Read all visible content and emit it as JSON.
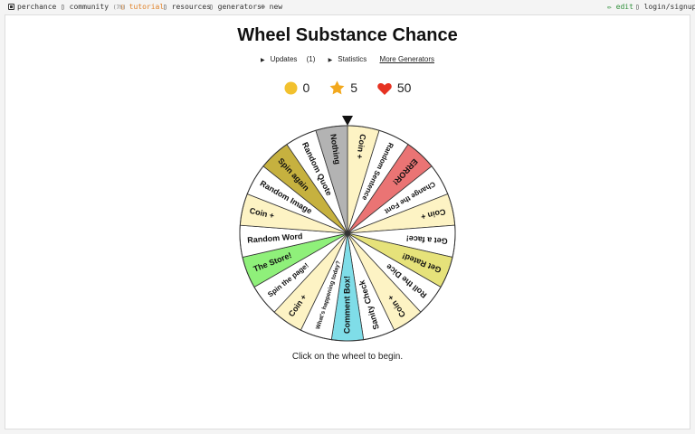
{
  "nav": {
    "brand": "perchance",
    "community": "community",
    "community_count": "(7h)",
    "tutorial": "tutorial",
    "resources": "resources",
    "generators": "generators",
    "new": "new",
    "edit": "edit",
    "login": "login/signup"
  },
  "page": {
    "title": "Wheel Substance Chance",
    "updates_label": "Updates",
    "updates_count": "(1)",
    "statistics_label": "Statistics",
    "more_generators": "More Generators",
    "instruction": "Click on the wheel to begin."
  },
  "stats": {
    "coins": "0",
    "stars": "5",
    "hearts": "50",
    "coin_color": "#f2c12e",
    "star_color": "#f2a81d",
    "heart_color": "#e63222"
  },
  "wheel": {
    "pointer_color": "#111111",
    "segments": [
      {
        "label": "Coin +",
        "color": "#fdf3c4"
      },
      {
        "label": "Random Sentence",
        "color": "#ffffff"
      },
      {
        "label": "ERROR!",
        "color": "#ea7474"
      },
      {
        "label": "Change the Font",
        "color": "#ffffff"
      },
      {
        "label": "Coin +",
        "color": "#fdf3c4"
      },
      {
        "label": "Get a face!",
        "color": "#ffffff"
      },
      {
        "label": "Get Rated!",
        "color": "#e6e27a"
      },
      {
        "label": "Roll the Dice",
        "color": "#ffffff"
      },
      {
        "label": "Coin +",
        "color": "#fdf3c4"
      },
      {
        "label": "Sanity Check",
        "color": "#ffffff"
      },
      {
        "label": "Comment Box!",
        "color": "#7fdde8"
      },
      {
        "label": "What's happening today?",
        "color": "#ffffff"
      },
      {
        "label": "Coin +",
        "color": "#fdf3c4"
      },
      {
        "label": "Spin the page!",
        "color": "#ffffff"
      },
      {
        "label": "The Store!",
        "color": "#8ff07a"
      },
      {
        "label": "Random Word",
        "color": "#ffffff"
      },
      {
        "label": "Coin +",
        "color": "#fdf3c4"
      },
      {
        "label": "Random Image",
        "color": "#ffffff"
      },
      {
        "label": "Spin again",
        "color": "#c6b13f"
      },
      {
        "label": "Random Quote",
        "color": "#ffffff"
      },
      {
        "label": "Nothing",
        "color": "#b3b3b3"
      }
    ]
  }
}
